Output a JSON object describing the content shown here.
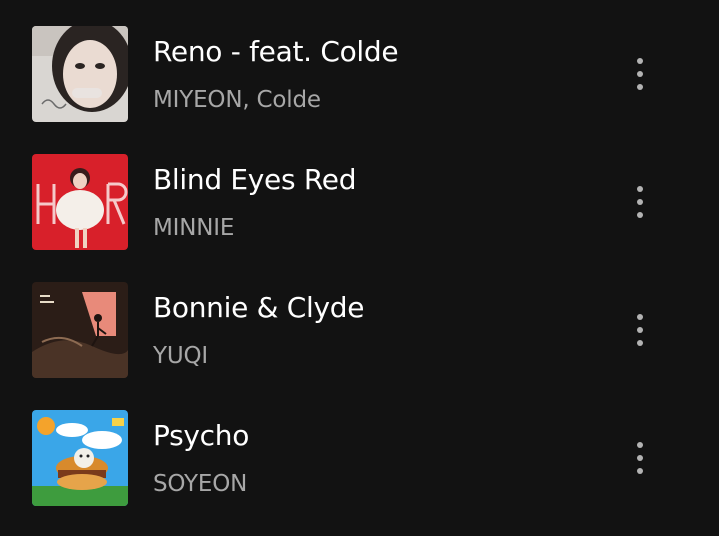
{
  "tracks": [
    {
      "title": "Reno - feat. Colde",
      "artist": "MIYEON, Colde",
      "art_icon": "album-cover-photo"
    },
    {
      "title": "Blind Eyes Red",
      "artist": "MINNIE",
      "art_icon": "album-cover-photo"
    },
    {
      "title": "Bonnie & Clyde",
      "artist": "YUQI",
      "art_icon": "album-cover-illustration"
    },
    {
      "title": "Psycho",
      "artist": "SOYEON",
      "art_icon": "album-cover-illustration"
    }
  ],
  "more_icon": "more-vertical-icon"
}
